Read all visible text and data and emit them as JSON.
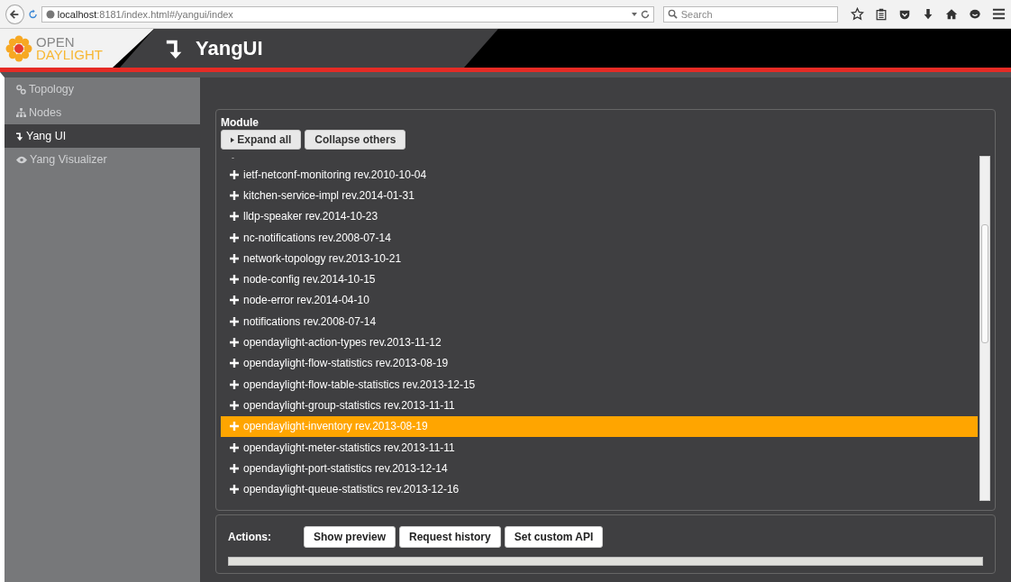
{
  "browser": {
    "url_host": "localhost",
    "url_rest": ":8181/index.html#/yangui/index",
    "search_placeholder": "Search"
  },
  "header": {
    "logo_top": "OPEN",
    "logo_bottom": "DAYLIGHT",
    "title": "YangUI"
  },
  "sidebar": {
    "items": [
      {
        "label": "Topology",
        "kind": "topology",
        "selected": false
      },
      {
        "label": "Nodes",
        "kind": "nodes",
        "selected": false
      },
      {
        "label": "Yang UI",
        "kind": "yang",
        "selected": true
      },
      {
        "label": "Yang Visualizer",
        "kind": "eye",
        "selected": false
      }
    ]
  },
  "module": {
    "title": "Module",
    "expand_all": "Expand all",
    "collapse_others": "Collapse others",
    "partial_row": "-",
    "items": [
      {
        "label": "ietf-netconf-monitoring rev.2010-10-04",
        "selected": false
      },
      {
        "label": "kitchen-service-impl rev.2014-01-31",
        "selected": false
      },
      {
        "label": "lldp-speaker rev.2014-10-23",
        "selected": false
      },
      {
        "label": "nc-notifications rev.2008-07-14",
        "selected": false
      },
      {
        "label": "network-topology rev.2013-10-21",
        "selected": false
      },
      {
        "label": "node-config rev.2014-10-15",
        "selected": false
      },
      {
        "label": "node-error rev.2014-04-10",
        "selected": false
      },
      {
        "label": "notifications rev.2008-07-14",
        "selected": false
      },
      {
        "label": "opendaylight-action-types rev.2013-11-12",
        "selected": false
      },
      {
        "label": "opendaylight-flow-statistics rev.2013-08-19",
        "selected": false
      },
      {
        "label": "opendaylight-flow-table-statistics rev.2013-12-15",
        "selected": false
      },
      {
        "label": "opendaylight-group-statistics rev.2013-11-11",
        "selected": false
      },
      {
        "label": "opendaylight-inventory rev.2013-08-19",
        "selected": true
      },
      {
        "label": "opendaylight-meter-statistics rev.2013-11-11",
        "selected": false
      },
      {
        "label": "opendaylight-port-statistics rev.2013-12-14",
        "selected": false
      },
      {
        "label": "opendaylight-queue-statistics rev.2013-12-16",
        "selected": false
      }
    ]
  },
  "actions": {
    "label": "Actions:",
    "buttons": [
      "Show preview",
      "Request history",
      "Set custom API"
    ]
  }
}
